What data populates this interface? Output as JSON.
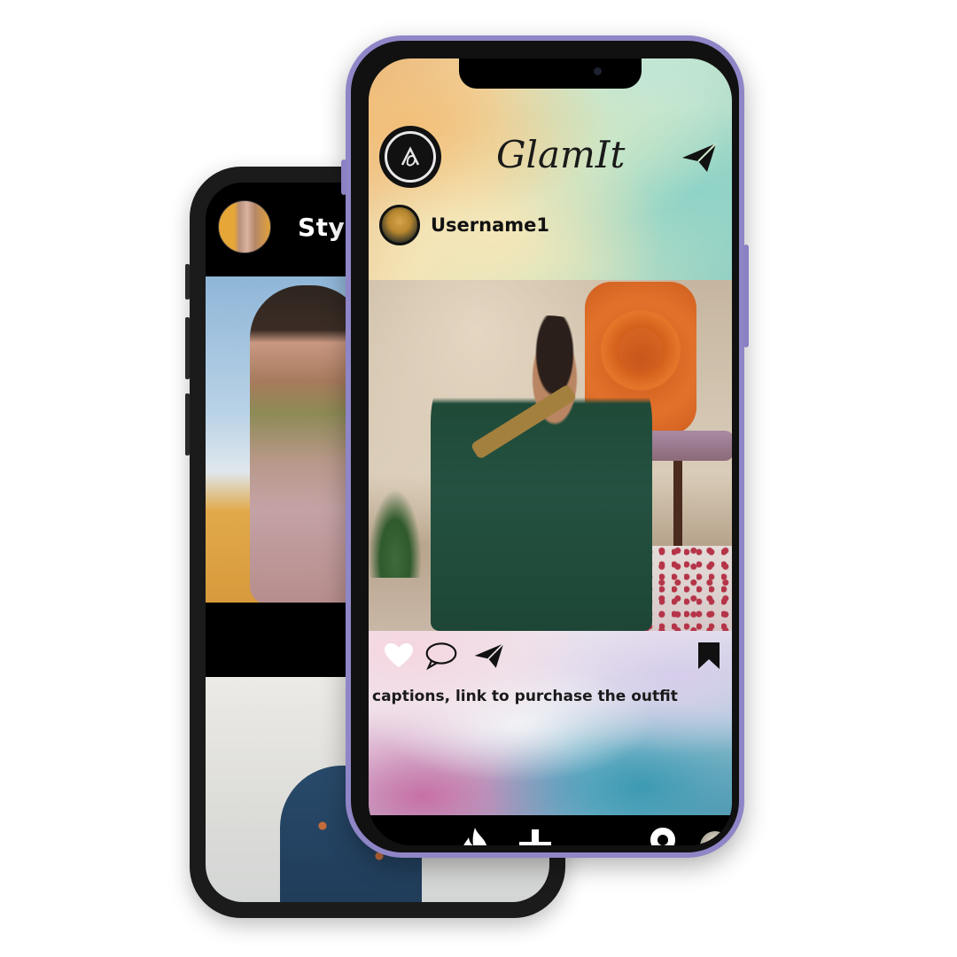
{
  "back_phone": {
    "header_title": "Styl"
  },
  "front_phone": {
    "app_title": "GlamIt",
    "post": {
      "username": "Username1",
      "caption": "captions, link to purchase the outfit"
    },
    "icons": {
      "logo": "brand-logo-icon",
      "send_top": "paper-plane-icon",
      "like": "heart-icon",
      "comment": "speech-bubble-icon",
      "share": "paper-plane-icon",
      "save": "bookmark-icon",
      "nav_trending": "flame-icon",
      "nav_add": "plus-icon",
      "nav_location": "map-pin-icon"
    },
    "colors": {
      "frame": "#8e86c7",
      "text": "#1a1a1a"
    }
  }
}
